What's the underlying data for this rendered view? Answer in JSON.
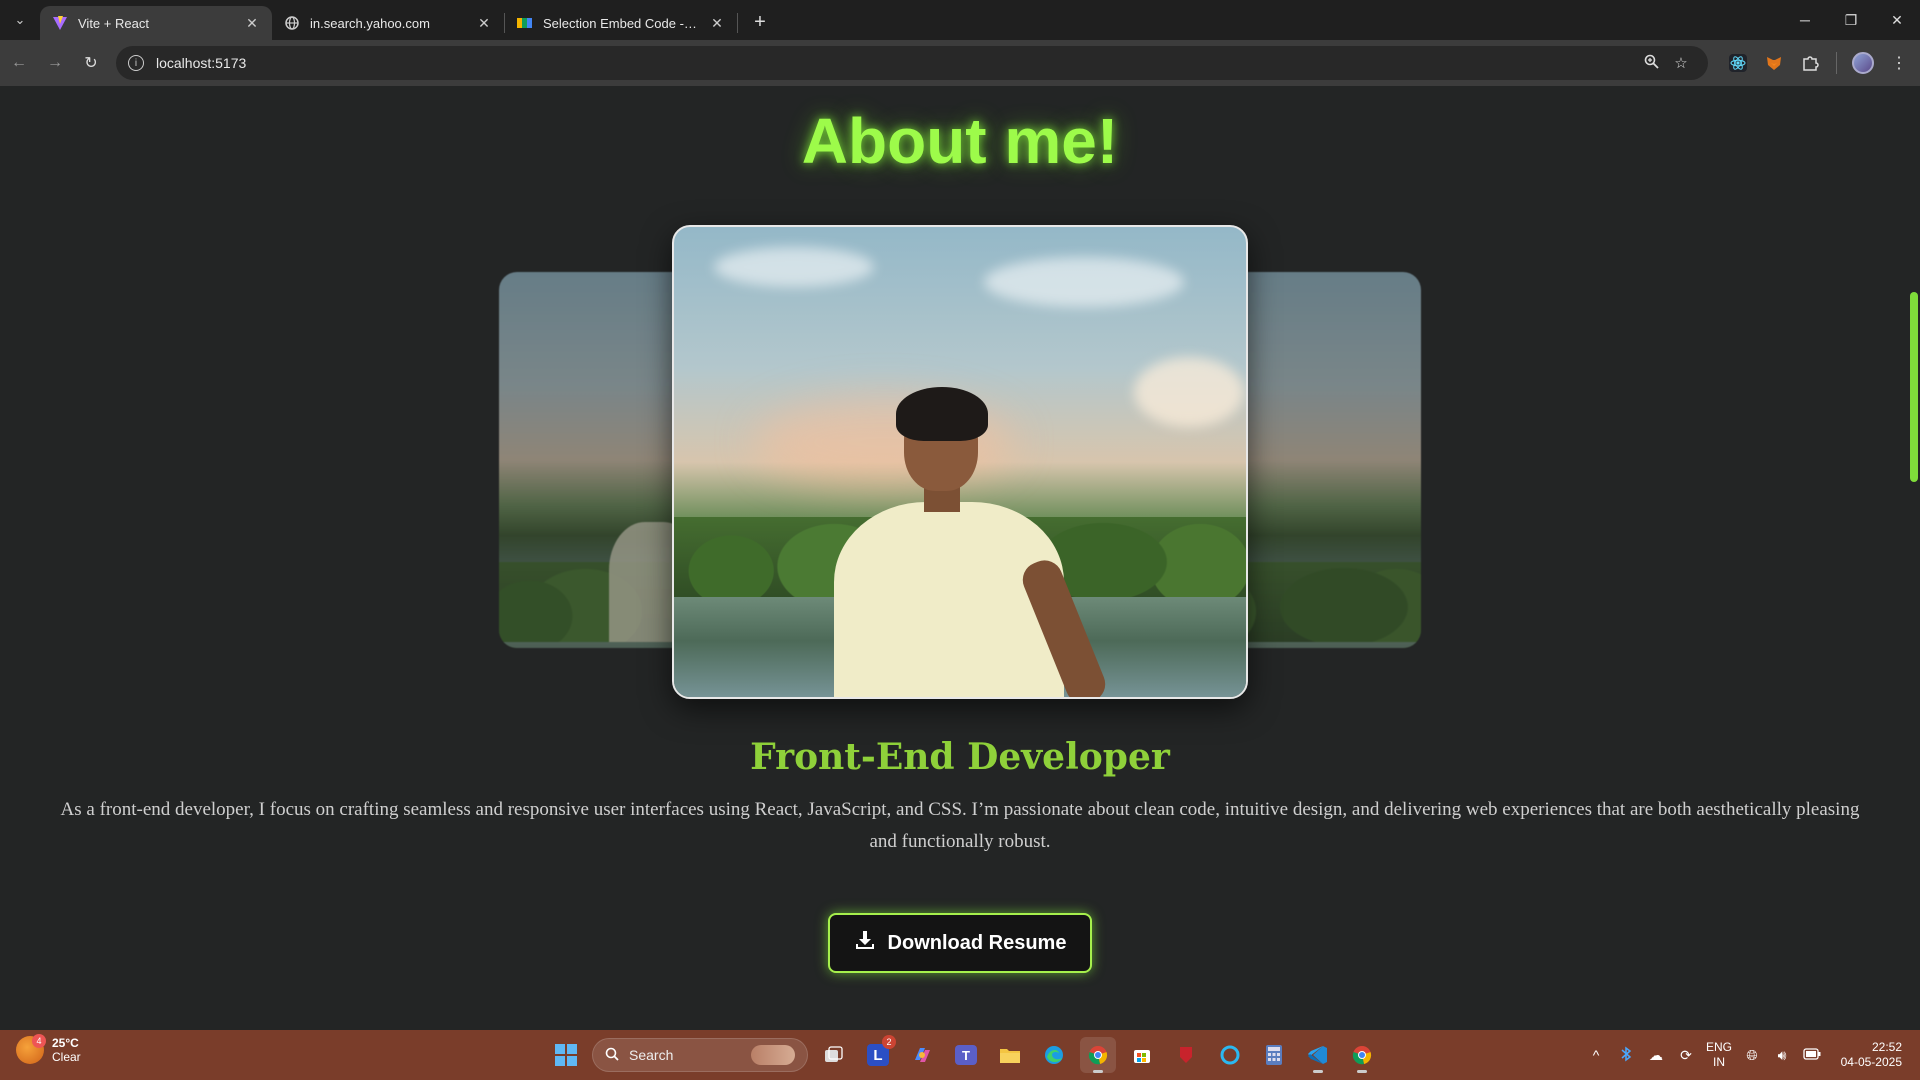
{
  "browser": {
    "tabs": [
      {
        "title": "Vite + React",
        "favicon": "vite-icon",
        "active": true
      },
      {
        "title": "in.search.yahoo.com",
        "favicon": "globe-icon",
        "active": false
      },
      {
        "title": "Selection Embed Code - Googl",
        "favicon": "google-sheets-icon",
        "active": false
      }
    ],
    "address": "localhost:5173"
  },
  "page": {
    "heading": "About me!",
    "role": "Front-End Developer",
    "bio": "As a front-end developer, I focus on crafting seamless and responsive user interfaces using React, JavaScript, and CSS. I’m passionate about clean code, intuitive design, and delivering web experiences that are both aesthetically pleasing and functionally robust.",
    "download_label": "Download Resume",
    "accent_color": "#9dfb4a"
  },
  "taskbar": {
    "weather_temp": "25°C",
    "weather_desc": "Clear",
    "weather_badge": "4",
    "search_placeholder": "Search",
    "teams_badge": "2",
    "lang_line1": "ENG",
    "lang_line2": "IN",
    "time": "22:52",
    "date": "04-05-2025"
  }
}
